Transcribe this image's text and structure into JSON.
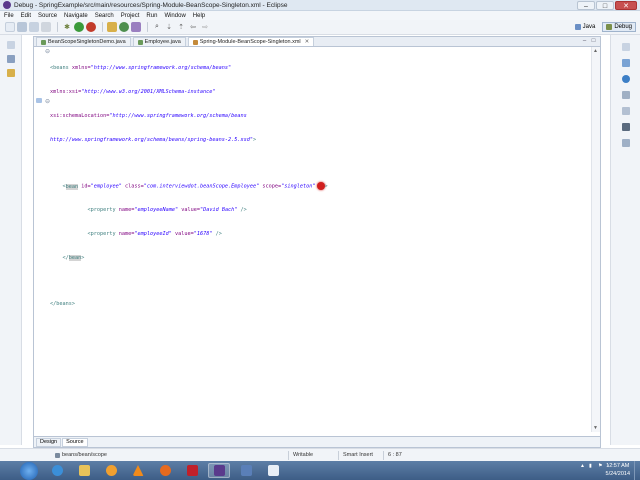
{
  "window": {
    "title": "Debug - SpringExample/src/main/resources/Spring-Module-BeanScope-Singleton.xml - Eclipse",
    "controls": [
      "–",
      "□",
      "✕"
    ]
  },
  "menu": [
    "File",
    "Edit",
    "Source",
    "Navigate",
    "Search",
    "Project",
    "Run",
    "Window",
    "Help"
  ],
  "perspectives": {
    "java": "Java",
    "debug": "Debug"
  },
  "tabs": [
    {
      "label": "BeanScopeSingletonDemo.java"
    },
    {
      "label": "Employee.java"
    },
    {
      "label": "Spring-Module-BeanScope-Singleton.xml",
      "active": true
    }
  ],
  "code": {
    "l1": {
      "tag": "<beans",
      "attr": " xmlns=",
      "val": "\"http://www.springframework.org/schema/beans\""
    },
    "l2": {
      "attr": "xmlns:xsi=",
      "val": "\"http://www.w3.org/2001/XMLSchema-instance\""
    },
    "l3": {
      "attr": "xsi:schemaLocation=",
      "val": "\"http://www.springframework.org/schema/beans"
    },
    "l4": {
      "val": "http://www.springframework.org/schema/beans/spring-beans-2.5.xsd\"",
      "tag": ">"
    },
    "l5": {
      "open": "<",
      "tag": "bean",
      "a1": " id=",
      "v1": "\"employee\"",
      "a2": " class=",
      "v2": "\"com.interviewdot.beanScope.Employee\"",
      "a3": " scope=",
      "v3": "\"singleton\"",
      "close": ">"
    },
    "l6": {
      "tag": "<property",
      "a1": " name=",
      "v1": "\"employeeName\"",
      "a2": " value=",
      "v2": "\"David Bach\"",
      "close": " />"
    },
    "l7": {
      "tag": "<property",
      "a1": " name=",
      "v1": "\"employeeId\"",
      "a2": " value=",
      "v2": "\"1678\"",
      "close": " />"
    },
    "l8": {
      "open": "</",
      "tag": "bean",
      "close": ">"
    },
    "l9": {
      "tag": "</beans>"
    }
  },
  "bottom_tabs": [
    "Design",
    "Source"
  ],
  "status": {
    "path": "beans/bean/scope",
    "writable": "Writable",
    "insert_mode": "Smart Insert",
    "position": "6 : 87"
  },
  "clock": {
    "time": "12:57 AM",
    "date": "5/24/2014"
  },
  "colors": {
    "tag": "#3f7f7f",
    "attribute": "#7f007f",
    "value": "#2a00ff",
    "cursor_marker": "#d11d1d"
  }
}
